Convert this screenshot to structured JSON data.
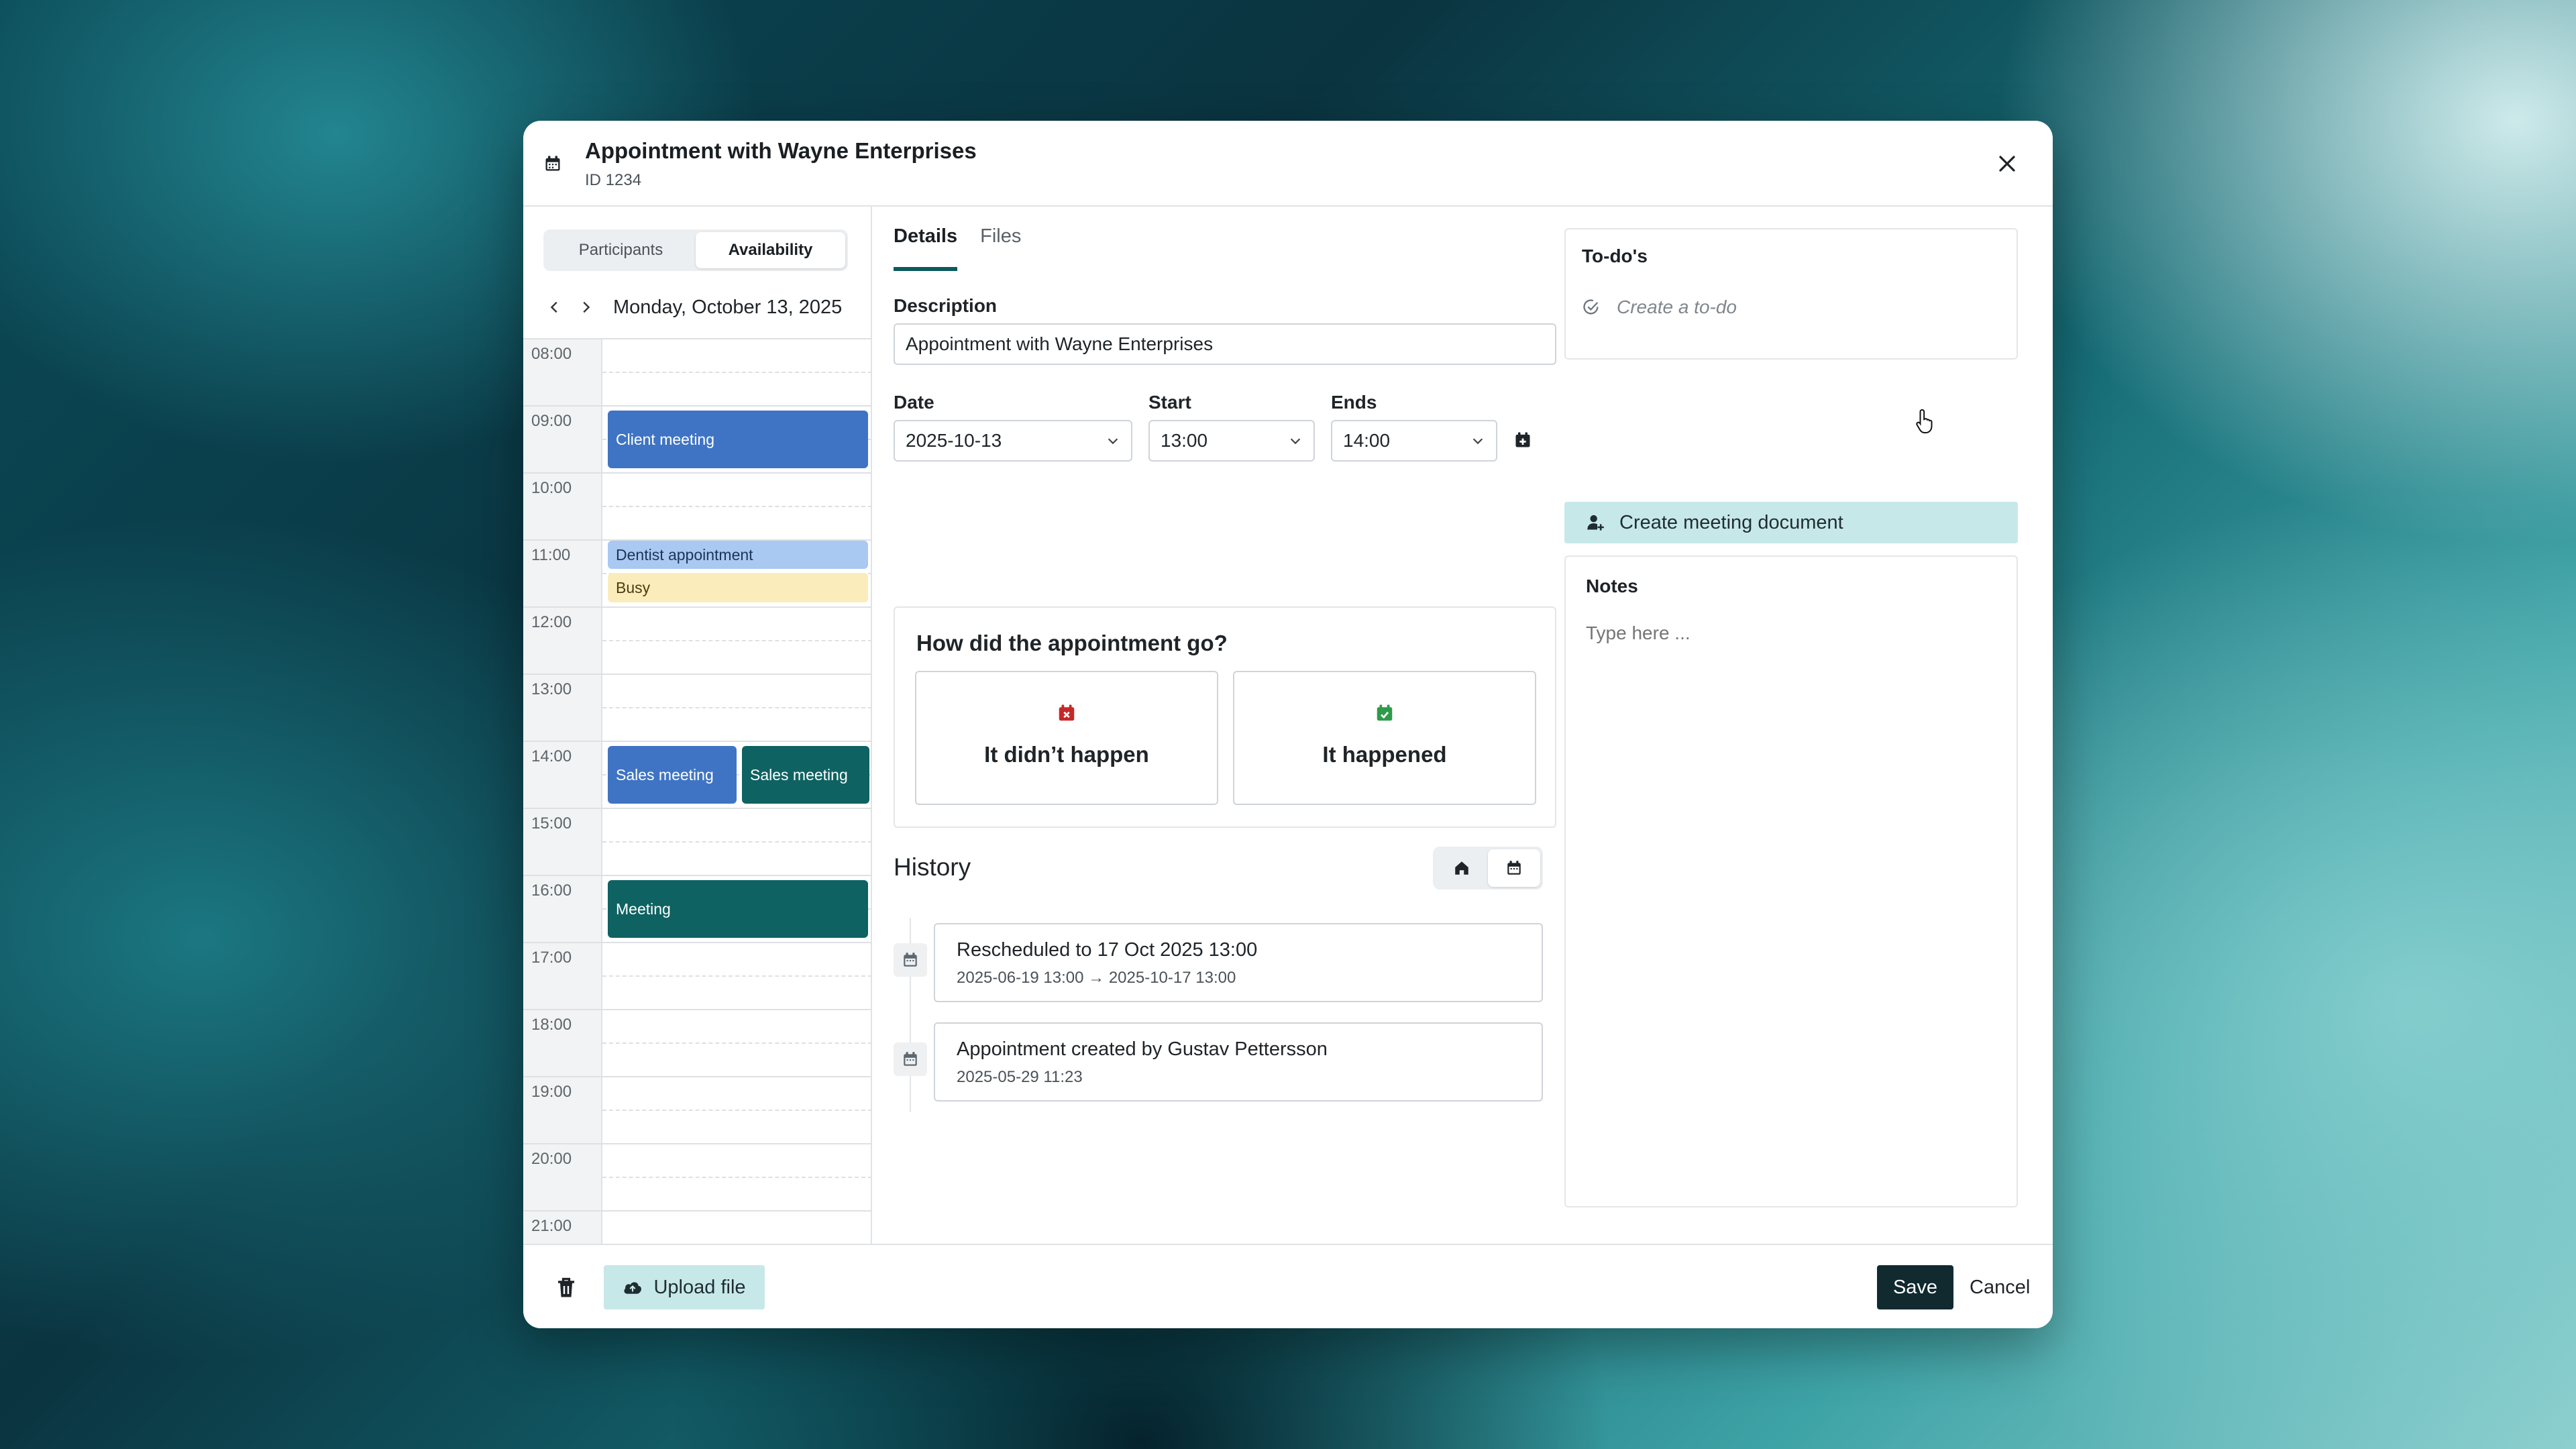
{
  "header": {
    "title": "Appointment with Wayne Enterprises",
    "subtitle": "ID 1234"
  },
  "left": {
    "segments": [
      "Participants",
      "Availability"
    ],
    "active_segment": "Availability",
    "date_label": "Monday, October 13, 2025",
    "hours": [
      "08:00",
      "09:00",
      "10:00",
      "11:00",
      "12:00",
      "13:00",
      "14:00",
      "15:00",
      "16:00",
      "17:00",
      "18:00",
      "19:00",
      "20:00",
      "21:00"
    ],
    "events": [
      {
        "label": "Client meeting",
        "color": "#3f74c4"
      },
      {
        "label": "Dentist appointment",
        "color": "#a9c8f2"
      },
      {
        "label": "Busy",
        "color": "#fbecbc"
      },
      {
        "label": "Sales meeting",
        "color": "#3f74c4"
      },
      {
        "label": "Sales meeting",
        "color": "#0f6262"
      },
      {
        "label": "Meeting",
        "color": "#0f6262"
      }
    ]
  },
  "main": {
    "tabs": [
      "Details",
      "Files"
    ],
    "active_tab": "Details",
    "description_label": "Description",
    "description_value": "Appointment with Wayne Enterprises",
    "date_label": "Date",
    "date_value": "2025-10-13",
    "start_label": "Start",
    "start_value": "13:00",
    "ends_label": "Ends",
    "ends_value": "14:00",
    "outcome_question": "How did the appointment go?",
    "outcome_no": "It didn’t happen",
    "outcome_yes": "It happened",
    "history_title": "History",
    "history": [
      {
        "title": "Rescheduled to 17 Oct 2025 13:00",
        "detail": "2025-06-19 13:00 → 2025-10-17 13:00"
      },
      {
        "title": "Appointment created by Gustav Pettersson",
        "detail": "2025-05-29 11:23"
      }
    ]
  },
  "right": {
    "todo_title": "To-do's",
    "todo_placeholder": "Create a to-do",
    "meeting_doc_label": "Create meeting document",
    "notes_title": "Notes",
    "notes_placeholder": "Type here ..."
  },
  "footer": {
    "upload_label": "Upload file",
    "save_label": "Save",
    "cancel_label": "Cancel"
  },
  "colors": {
    "accent_dark": "#102a30",
    "accent_light": "#c7e8e8",
    "danger": "#c62828",
    "success": "#2e9b4a"
  }
}
